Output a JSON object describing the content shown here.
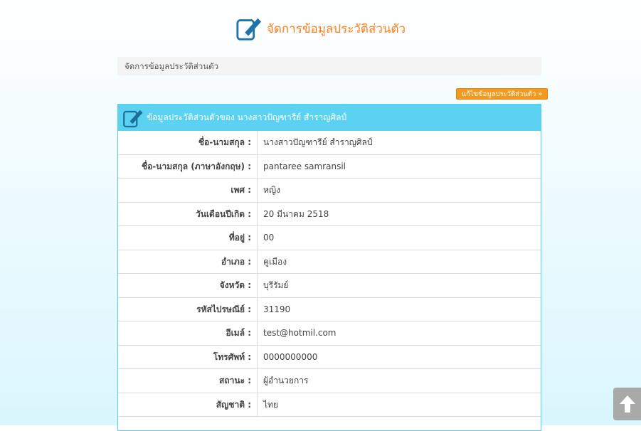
{
  "header": {
    "title": "จัดการข้อมูลประวัติส่วนตัว",
    "icon": "edit-document-icon"
  },
  "breadcrumb": {
    "text": "จัดการข้อมูลประวัติส่วนตัว"
  },
  "actions": {
    "edit_label": "แก้ไขข้อมูลประวัติส่วนตัว »"
  },
  "panel": {
    "title": "ข้อมูลประวัติส่วนตัวของ นางสาวปัญฑารีย์ สำราญศิลป์",
    "rows": [
      {
        "label": "ชื่อ-นามสกุล :",
        "value": "นางสาวปัญฑารีย์ สำราญศิลป์"
      },
      {
        "label": "ชื่อ-นามสกุล (ภาษาอังกฤษ) :",
        "value": "pantaree samransil"
      },
      {
        "label": "เพศ :",
        "value": "หญิง"
      },
      {
        "label": "วันเดือนปีเกิด :",
        "value": "20 มีนาคม 2518"
      },
      {
        "label": "ที่อยู่ :",
        "value": "00"
      },
      {
        "label": "อำเภอ :",
        "value": "คูเมือง"
      },
      {
        "label": "จังหวัด :",
        "value": "บุรีรัมย์"
      },
      {
        "label": "รหัสไปรษณีย์ :",
        "value": "31190"
      },
      {
        "label": "อีเมล์ :",
        "value": "test@hotmil.com"
      },
      {
        "label": "โทรศัพท์ :",
        "value": "0000000000"
      },
      {
        "label": "สถานะ :",
        "value": "ผู้อำนวยการ"
      },
      {
        "label": "สัญชาติ :",
        "value": "ไทย"
      }
    ]
  },
  "colors": {
    "accent": "#ff7f1a",
    "panel_header": "#5bd2f2",
    "button": "#f19a1f"
  },
  "scroll_top_icon": "arrow-up-icon"
}
